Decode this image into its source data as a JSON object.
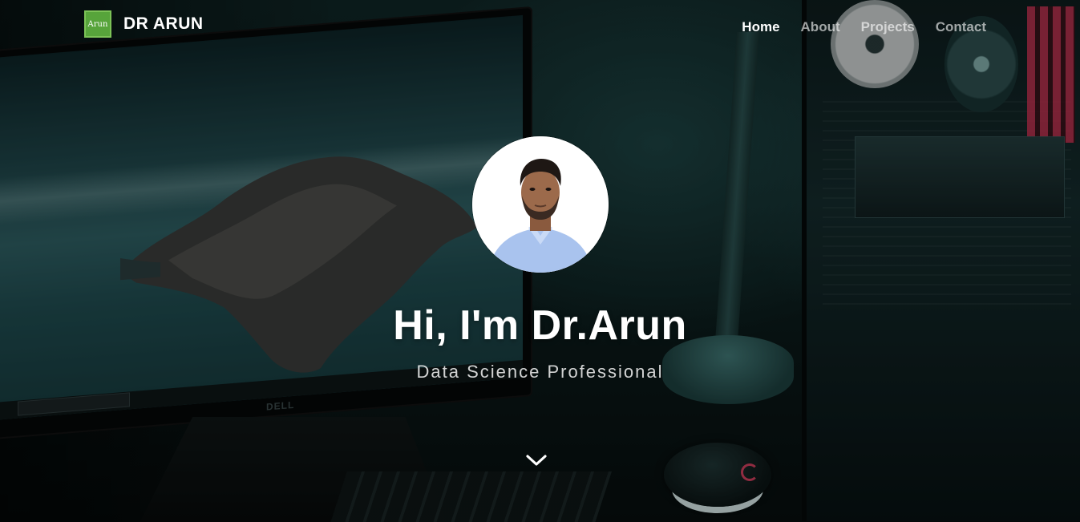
{
  "brand": {
    "logo_text": "Arun",
    "name": "DR ARUN"
  },
  "nav": {
    "links": [
      {
        "label": "Home",
        "active": true
      },
      {
        "label": "About",
        "active": false
      },
      {
        "label": "Projects",
        "active": false
      },
      {
        "label": "Contact",
        "active": false
      }
    ]
  },
  "hero": {
    "headline": "Hi, I'm Dr.Arun",
    "subtitle": "Data Science Professional",
    "scroll_icon": "chevron-down-icon"
  },
  "colors": {
    "logo_green": "#57a43b",
    "text_white": "#ffffff",
    "muted_nav": "rgba(255,255,255,0.62)"
  }
}
